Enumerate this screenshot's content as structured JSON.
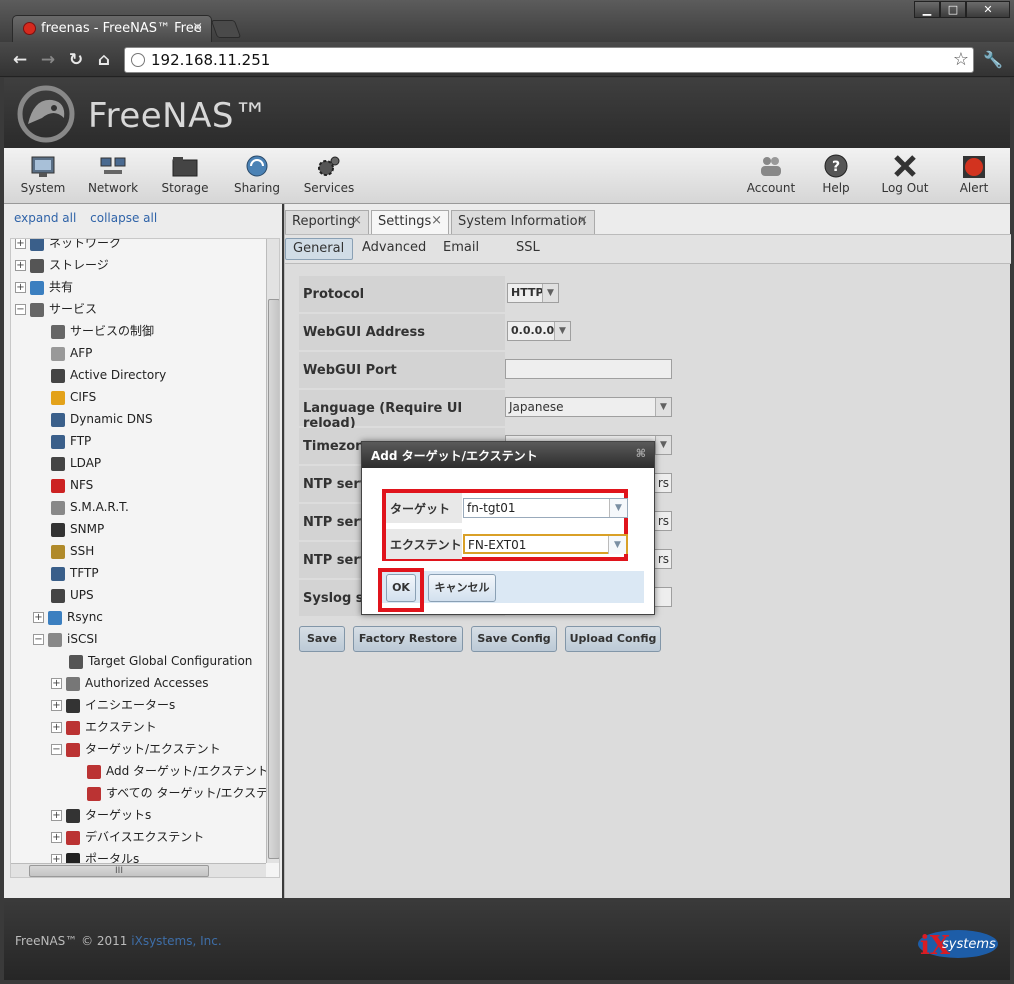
{
  "browser": {
    "tab_title": "freenas - FreeNAS™ Free",
    "tab_close": "×",
    "url": "192.168.11.251",
    "win_min": "▁",
    "win_max": "□",
    "win_close": "✕"
  },
  "header": {
    "logo_text": "FreeNAS™"
  },
  "nav": {
    "items": [
      {
        "label": "System",
        "icon": "system-icon"
      },
      {
        "label": "Network",
        "icon": "network-icon"
      },
      {
        "label": "Storage",
        "icon": "storage-icon"
      },
      {
        "label": "Sharing",
        "icon": "sharing-icon"
      },
      {
        "label": "Services",
        "icon": "services-icon"
      },
      {
        "label": "Account",
        "icon": "account-icon"
      },
      {
        "label": "Help",
        "icon": "help-icon"
      },
      {
        "label": "Log Out",
        "icon": "logout-icon"
      },
      {
        "label": "Alert",
        "icon": "alert-icon"
      }
    ]
  },
  "tree": {
    "expand_all": "expand all",
    "collapse_all": "collapse all",
    "items": [
      {
        "label": "ネットワーク",
        "exp": "+"
      },
      {
        "label": "ストレージ",
        "exp": "+"
      },
      {
        "label": "共有",
        "exp": "+"
      },
      {
        "label": "サービス",
        "exp": "−"
      },
      {
        "label": "サービスの制御",
        "exp": ""
      },
      {
        "label": "AFP",
        "exp": ""
      },
      {
        "label": "Active Directory",
        "exp": ""
      },
      {
        "label": "CIFS",
        "exp": ""
      },
      {
        "label": "Dynamic DNS",
        "exp": ""
      },
      {
        "label": "FTP",
        "exp": ""
      },
      {
        "label": "LDAP",
        "exp": ""
      },
      {
        "label": "NFS",
        "exp": ""
      },
      {
        "label": "S.M.A.R.T.",
        "exp": ""
      },
      {
        "label": "SNMP",
        "exp": ""
      },
      {
        "label": "SSH",
        "exp": ""
      },
      {
        "label": "TFTP",
        "exp": ""
      },
      {
        "label": "UPS",
        "exp": ""
      },
      {
        "label": "Rsync",
        "exp": "+"
      },
      {
        "label": "iSCSI",
        "exp": "−"
      },
      {
        "label": "Target Global Configuration",
        "exp": ""
      },
      {
        "label": "Authorized Accesses",
        "exp": "+"
      },
      {
        "label": "イニシエーターs",
        "exp": "+"
      },
      {
        "label": "エクステント",
        "exp": "+"
      },
      {
        "label": "ターゲット/エクステント",
        "exp": "−"
      },
      {
        "label": "Add ターゲット/エクステント",
        "exp": ""
      },
      {
        "label": "すべての ターゲット/エクステント",
        "exp": ""
      },
      {
        "label": "ターゲットs",
        "exp": "+"
      },
      {
        "label": "デバイスエクステント",
        "exp": "+"
      },
      {
        "label": "ポータルs",
        "exp": "+"
      }
    ],
    "hscroll_grip": "III"
  },
  "content": {
    "top_tabs": [
      "Reporting",
      "Settings",
      "System Information"
    ],
    "sub_tabs": [
      "General",
      "Advanced",
      "Email",
      "SSL"
    ],
    "form": {
      "protocol_label": "Protocol",
      "protocol_value": "HTTP",
      "webgui_address_label": "WebGUI Address",
      "webgui_address_value": "0.0.0.0",
      "webgui_port_label": "WebGUI Port",
      "webgui_port_value": "",
      "language_label": "Language (Require UI reload)",
      "language_value": "Japanese",
      "timezone_label": "Timezone",
      "ntp1_label": "NTP server",
      "ntp2_label": "NTP server",
      "ntp3_label": "NTP server",
      "ntp_suffix": "rs",
      "syslog_label": "Syslog se"
    },
    "buttons": [
      "Save",
      "Factory Restore",
      "Save Config",
      "Upload Config"
    ]
  },
  "dialog": {
    "title": "Add ターゲット/エクステント",
    "close": "⌘",
    "target_label": "ターゲット",
    "target_value": "fn-tgt01",
    "extent_label": "エクステント",
    "extent_value": "FN-EXT01",
    "ok": "OK",
    "cancel": "キャンセル"
  },
  "footer": {
    "copyright": "FreeNAS™ © 2011",
    "company": "iXsystems, Inc.",
    "ix_logo_text": "systems"
  },
  "colors": {
    "highlight_red": "#e0141c",
    "link_blue": "#2f63a8"
  }
}
